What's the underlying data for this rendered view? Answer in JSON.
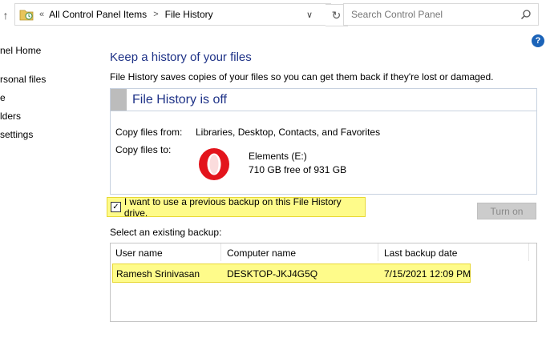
{
  "address_bar": {
    "overflow_chevron": "«",
    "breadcrumbs": [
      "All Control Panel Items",
      "File History"
    ],
    "separator": ">",
    "dropdown_glyph": "∨",
    "refresh_glyph": "↻"
  },
  "up_glyph": "↑",
  "search": {
    "placeholder": "Search Control Panel",
    "icon": "search-icon"
  },
  "help_glyph": "?",
  "sidebar": {
    "items": [
      {
        "label": "nel Home"
      },
      {
        "label": "rsonal files"
      },
      {
        "label": "e"
      },
      {
        "label": "lders"
      },
      {
        "label": "settings"
      }
    ]
  },
  "main": {
    "title": "Keep a history of your files",
    "description": "File History saves copies of your files so you can get them back if they're lost or damaged.",
    "status_panel": {
      "heading": "File History is off",
      "copy_from_label": "Copy files from:",
      "copy_from_value": "Libraries, Desktop, Contacts, and Favorites",
      "copy_to_label": "Copy files to:",
      "drive_icon": "opera-icon",
      "drive_name": "Elements (E:)",
      "drive_space": "710 GB free of 931 GB"
    },
    "use_previous_backup": {
      "checked": true,
      "check_glyph": "✓",
      "label": "I want to use a previous backup on this File History drive."
    },
    "turn_on_button": "Turn on",
    "select_label": "Select an existing backup:",
    "backup_table": {
      "columns": [
        "User name",
        "Computer name",
        "Last backup date"
      ],
      "rows": [
        [
          "Ramesh Srinivasan",
          "DESKTOP-JKJ4G5Q",
          "7/15/2021 12:09 PM"
        ]
      ]
    }
  },
  "colors": {
    "title_blue": "#1e3287",
    "highlight_yellow": "#fefb8a",
    "help_blue": "#1b63b8"
  }
}
